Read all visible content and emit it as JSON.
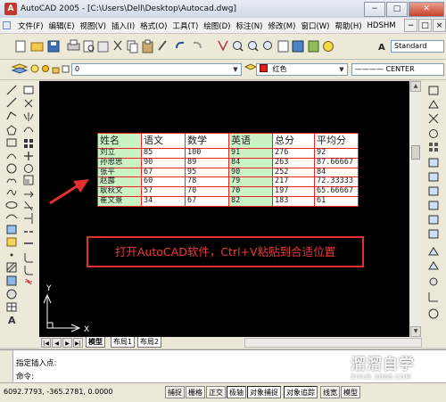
{
  "window": {
    "title": "AutoCAD 2005 - [C:\\Users\\Dell\\Desktop\\Autocad.dwg]",
    "app_icon_label": "A",
    "controls": [
      "−",
      "□",
      "✕"
    ]
  },
  "menu": {
    "items": [
      "文件(F)",
      "编辑(E)",
      "视图(V)",
      "插入(I)",
      "格式(O)",
      "工具(T)",
      "绘图(D)",
      "标注(N)",
      "修改(M)",
      "窗口(W)",
      "帮助(H)",
      "HDSHM"
    ],
    "doc_controls": [
      "−",
      "□",
      "×"
    ]
  },
  "toolbar": {
    "text_style": "Standard",
    "layer_value": "0",
    "color_value": "红色",
    "color_swatch": "#e02020",
    "linetype_value": "———— CENTER",
    "dropdown_arrow": "▼"
  },
  "table": {
    "headers": [
      "姓名",
      "语文",
      "数学",
      "英语",
      "总分",
      "平均分"
    ],
    "rows": [
      [
        "刘立",
        "85",
        "100",
        "91",
        "276",
        "92"
      ],
      [
        "孙思思",
        "90",
        "89",
        "84",
        "263",
        "87.66667"
      ],
      [
        "张平",
        "67",
        "95",
        "90",
        "252",
        "84"
      ],
      [
        "赵露",
        "60",
        "78",
        "79",
        "217",
        "72.33333"
      ],
      [
        "耿秋文",
        "57",
        "70",
        "70",
        "197",
        "65.66667"
      ],
      [
        "崔文景",
        "34",
        "67",
        "82",
        "183",
        "61"
      ]
    ]
  },
  "callout": {
    "text": "打开AutoCAD软件，Ctrl+V粘贴到合适位置"
  },
  "ucs": {
    "x_label": "X",
    "y_label": "Y"
  },
  "tabs": {
    "items": [
      "模型",
      "布局1",
      "布局2"
    ],
    "nav": [
      "|◀",
      "◀",
      "▶",
      "▶|"
    ]
  },
  "command": {
    "line1": "指定插入点:",
    "line2": "命令:"
  },
  "status": {
    "coords": "6092.7793, -365.2781, 0.0000",
    "buttons": [
      "捕捉",
      "栅格",
      "正交",
      "极轴",
      "对象捕捉",
      "对象追踪",
      "线宽",
      "模型"
    ]
  },
  "watermark": {
    "title": "溜溜自学",
    "subtitle": "ZIXUE.3D66.COM"
  }
}
